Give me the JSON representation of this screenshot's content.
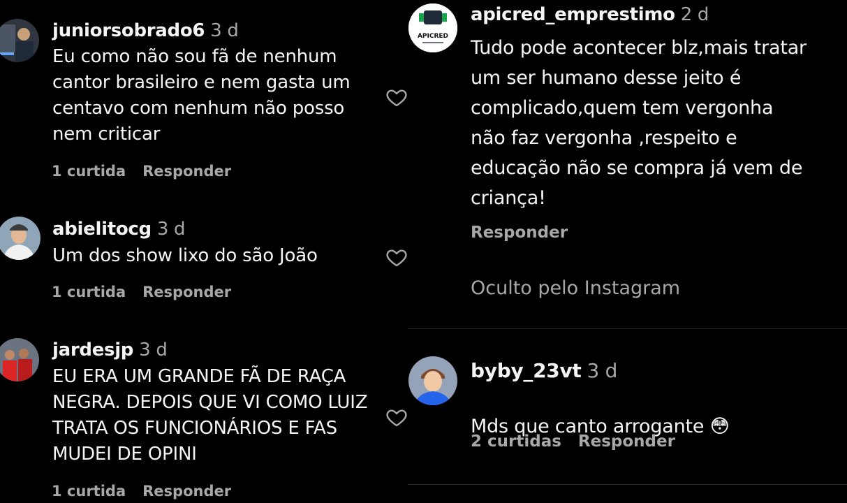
{
  "comments_left": [
    {
      "username": "juniorsobrado6",
      "time": "3 d",
      "text": "Eu como não sou fã de nenhum\ncantor brasileiro e nem gasta um\ncentavo com nenhum não posso\nnem criticar",
      "likes": "1 curtida",
      "reply": "Responder"
    },
    {
      "username": "abielitocg",
      "time": "3 d",
      "text": "Um dos show lixo do são João",
      "likes": "1 curtida",
      "reply": "Responder"
    },
    {
      "username": "jardesjp",
      "time": "3 d",
      "text": "EU ERA UM GRANDE FÃ DE RAÇA\nNEGRA. DEPOIS QUE VI COMO LUIZ\nTRATA OS FUNCIONÁRIOS E FAS\nMUDEI DE OPINI",
      "likes": "1 curtida",
      "reply": "Responder"
    }
  ],
  "comments_right": [
    {
      "username": "apicred_emprestimo",
      "time": "2 d",
      "avatar_text": "APICRED",
      "text": "Tudo pode acontecer blz,mais tratar\num ser humano desse jeito é\ncomplicado,quem tem vergonha\nnão faz vergonha ,respeito e\neducação não se compra já vem de\ncriança!",
      "reply": "Responder",
      "hidden_note": "Oculto pelo Instagram"
    },
    {
      "username": "byby_23vt",
      "time": "3 d",
      "text": "Mds que canto arrogante 😳",
      "likes": "2 curtidas",
      "reply": "Responder"
    }
  ],
  "colors": {
    "background": "#000000",
    "text": "#f5f5f5",
    "secondary": "#a8a8a8",
    "divider": "#262626"
  },
  "icons": [
    "heart-outline-icon",
    "flushed-face-emoji"
  ]
}
